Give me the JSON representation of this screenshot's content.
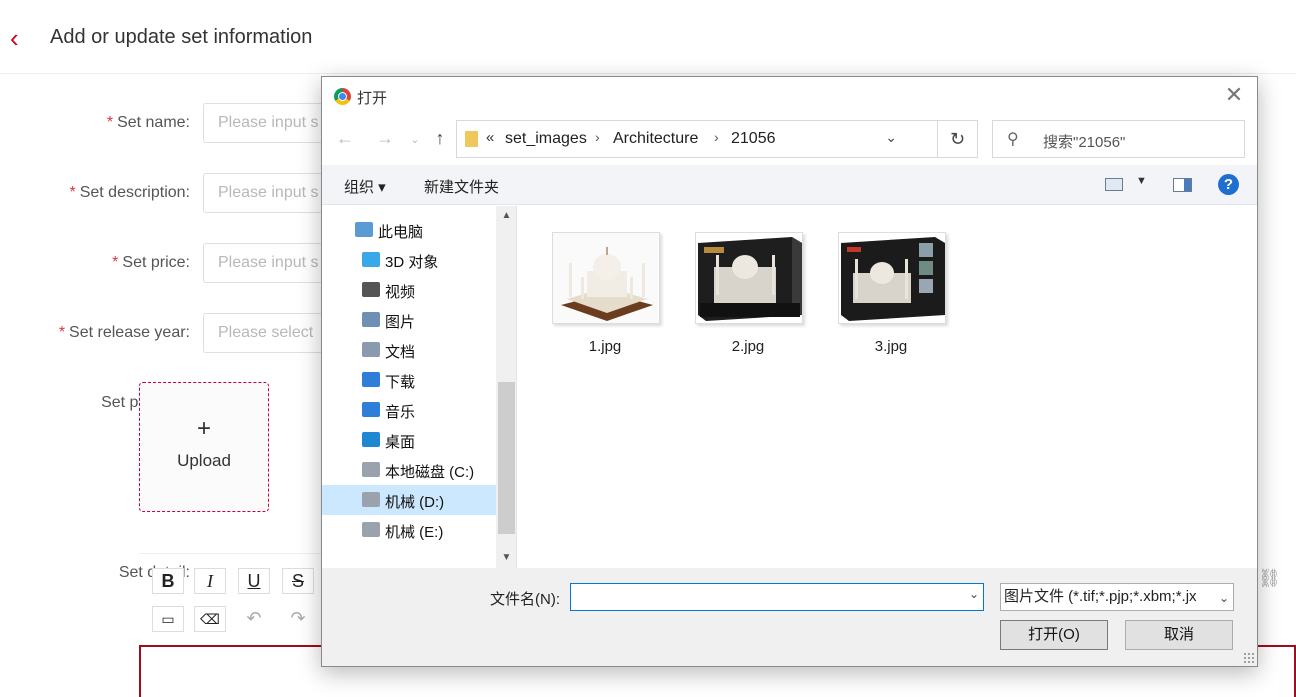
{
  "page": {
    "title": "Add or update set information",
    "form": {
      "set_name_label": "Set name:",
      "set_name_placeholder": "Please input s",
      "set_description_label": "Set description:",
      "set_description_placeholder": "Please input s",
      "set_price_label": "Set price:",
      "set_price_placeholder": "Please input s",
      "set_release_year_label": "Set release year:",
      "set_release_year_placeholder": "Please select",
      "set_pictures_label": "Set pictures:",
      "upload_label": "Upload",
      "set_detail_label": "Set detail:"
    },
    "editor_toolbar": {
      "bold": "B",
      "italic": "I",
      "underline": "U",
      "strike": "S"
    }
  },
  "dialog": {
    "title": "打开",
    "address": {
      "overflow": "«",
      "crumbs": [
        "set_images",
        "Architecture",
        "21056"
      ]
    },
    "search_placeholder": "搜索\"21056\"",
    "commands": {
      "organize": "组织 ▾",
      "new_folder": "新建文件夹"
    },
    "tree": [
      {
        "label": "此电脑",
        "icon": "computer-icon",
        "color": "#5b9bd5"
      },
      {
        "label": "3D 对象",
        "icon": "cube-icon",
        "color": "#3aa7e8"
      },
      {
        "label": "视频",
        "icon": "film-icon",
        "color": "#555555"
      },
      {
        "label": "图片",
        "icon": "picture-icon",
        "color": "#6f8fb5"
      },
      {
        "label": "文档",
        "icon": "document-icon",
        "color": "#8a9bb0"
      },
      {
        "label": "下载",
        "icon": "download-icon",
        "color": "#2f7fd8"
      },
      {
        "label": "音乐",
        "icon": "music-icon",
        "color": "#2f7fd8"
      },
      {
        "label": "桌面",
        "icon": "desktop-icon",
        "color": "#1e88d0"
      },
      {
        "label": "本地磁盘 (C:)",
        "icon": "drive-icon",
        "color": "#9aa3ad"
      },
      {
        "label": "机械 (D:)",
        "icon": "drive-icon",
        "color": "#9aa3ad",
        "selected": true
      },
      {
        "label": "机械 (E:)",
        "icon": "drive-icon",
        "color": "#9aa3ad"
      }
    ],
    "files": [
      {
        "name": "1.jpg"
      },
      {
        "name": "2.jpg"
      },
      {
        "name": "3.jpg"
      }
    ],
    "filename_label": "文件名(N):",
    "filename_value": "",
    "filter_value": "图片文件 (*.tif;*.pjp;*.xbm;*.jx",
    "open_button": "打开(O)",
    "cancel_button": "取消"
  },
  "colors": {
    "accent": "#c8102e",
    "selection": "#cce8ff",
    "focus": "#0078d7"
  }
}
